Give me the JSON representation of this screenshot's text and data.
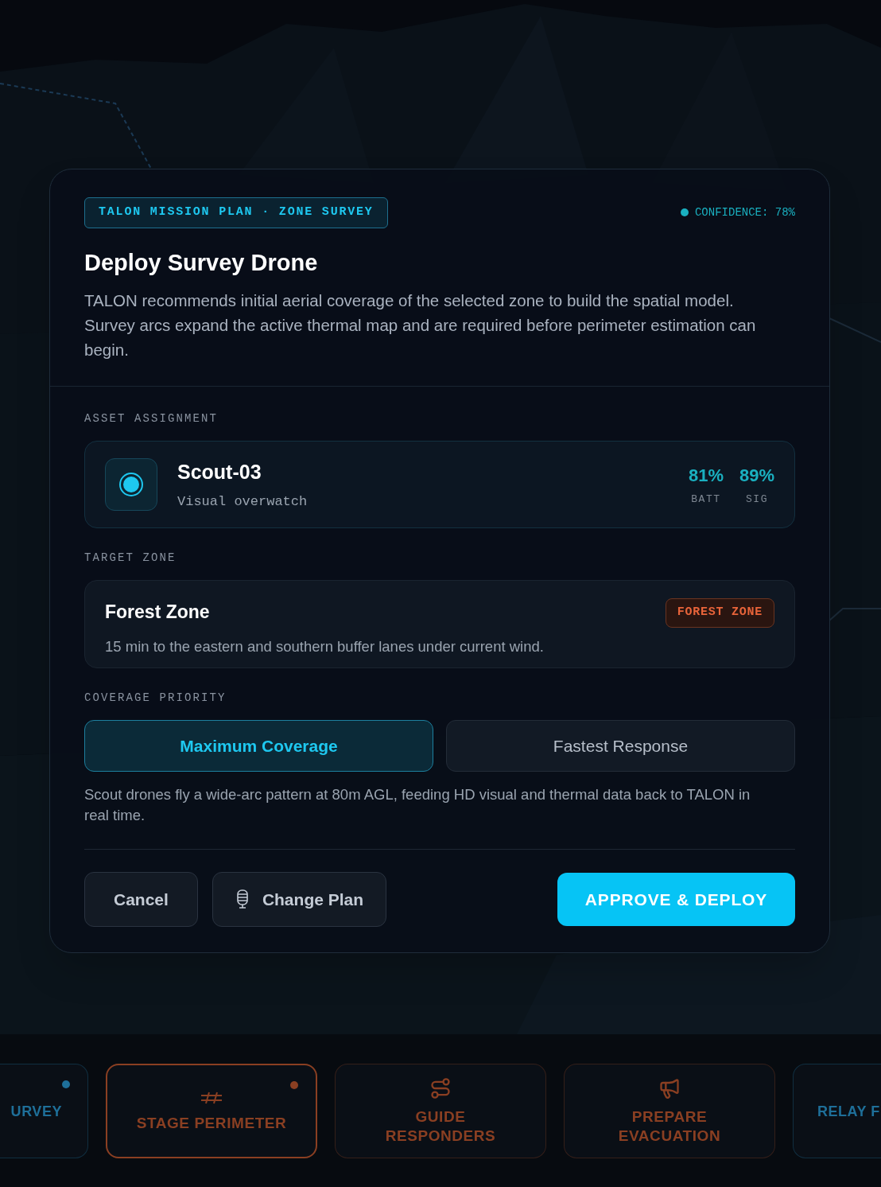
{
  "dialog": {
    "tag": "TALON MISSION PLAN · ZONE SURVEY",
    "confidence": "CONFIDENCE: 78%",
    "title": "Deploy Survey Drone",
    "description": "TALON recommends initial aerial coverage of the selected zone to build the spatial model. Survey arcs expand the active thermal map and are required before perimeter estimation can begin."
  },
  "asset_assignment": {
    "label": "ASSET ASSIGNMENT",
    "name": "Scout-03",
    "role": "Visual overwatch",
    "stats": [
      {
        "value": "81%",
        "label": "BATT"
      },
      {
        "value": "89%",
        "label": "SIG"
      }
    ]
  },
  "target_zone": {
    "label": "TARGET ZONE",
    "name": "Forest Zone",
    "detail": "15 min to the eastern and southern buffer lanes under current wind.",
    "badge": "FOREST ZONE"
  },
  "coverage_priority": {
    "label": "COVERAGE PRIORITY",
    "options": [
      {
        "label": "Maximum Coverage",
        "selected": true
      },
      {
        "label": "Fastest Response",
        "selected": false
      }
    ],
    "note": "Scout drones fly a wide-arc pattern at 80m AGL, feeding HD visual and thermal data back to TALON in real time."
  },
  "buttons": [
    {
      "label": "Cancel",
      "kind": "plain"
    },
    {
      "label": "Change Plan",
      "kind": "icon"
    },
    {
      "label": "APPROVE & DEPLOY",
      "kind": "primary"
    }
  ],
  "action_cards": [
    {
      "label": "URVEY",
      "color": "#1e6f99",
      "dot": true,
      "selected": false,
      "kind": "cut_left"
    },
    {
      "label": "STAGE PERIMETER",
      "color": "#8a3f22",
      "dot": true,
      "selected": true,
      "kind": "perimeter"
    },
    {
      "label": "GUIDE RESPONDERS",
      "color": "#8a3f22",
      "dot": false,
      "selected": false,
      "kind": "route"
    },
    {
      "label": "PREPARE EVACUATION",
      "color": "#8a3f22",
      "dot": false,
      "selected": false,
      "kind": "megaphone"
    },
    {
      "label": "RELAY F",
      "color": "#1e6f99",
      "dot": false,
      "selected": false,
      "kind": "cut_right"
    }
  ]
}
